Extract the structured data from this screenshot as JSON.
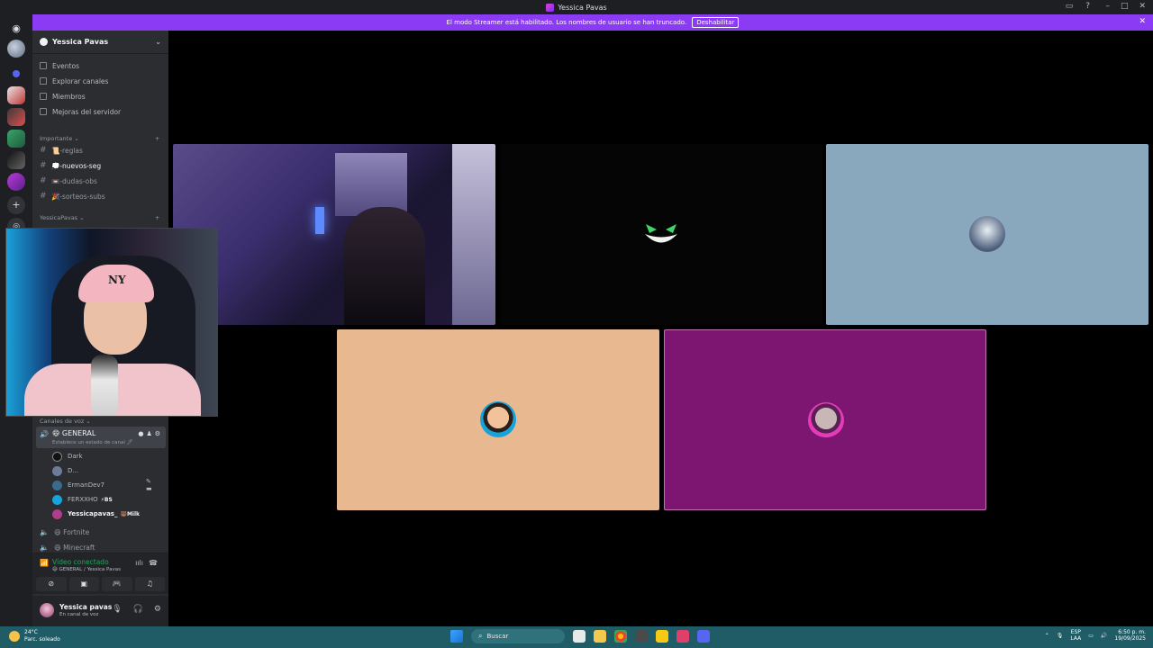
{
  "window": {
    "title": "Yessica Pavas"
  },
  "banner": {
    "text": "El modo Streamer está habilitado. Los nombres de usuario se han truncado.",
    "button": "Deshabilitar"
  },
  "server": {
    "name": "Yessica Pavas"
  },
  "nav": [
    {
      "label": "Eventos"
    },
    {
      "label": "Explorar canales"
    },
    {
      "label": "Miembros"
    },
    {
      "label": "Mejoras del servidor"
    }
  ],
  "categories": {
    "importante": "Importante",
    "yessica": "YessicaPavas",
    "voice": "Canales de voz"
  },
  "text_channels": [
    {
      "label": "📜-reglas"
    },
    {
      "label": "💭-nuevos-seg"
    },
    {
      "label": "📼-dudas-obs"
    },
    {
      "label": "🎉-sorteos-subs"
    }
  ],
  "voice": {
    "channel": "😄 GENERAL",
    "status": "Establece un estado de canal 🖊",
    "users": [
      {
        "name": "Dark",
        "tag": "",
        "color": "#111111"
      },
      {
        "name": "D...",
        "tag": "",
        "color": "#6f7c99"
      },
      {
        "name": "ErmanDev7",
        "tag": "",
        "color": "#3a6b8c"
      },
      {
        "name": "FERXXHO",
        "tag": "⚡BS",
        "color": "#16a3d9"
      },
      {
        "name": "Yessicapavas_",
        "tag": "🐻Milk",
        "color": "#b03c8a"
      }
    ],
    "other_channels": [
      {
        "label": "😄 Fortnite"
      },
      {
        "label": "😄 Minecraft"
      }
    ]
  },
  "rtc": {
    "title": "Vídeo conectado",
    "sub": "😄 GENERAL / Yessica Pavas"
  },
  "user": {
    "name": "Yessica pavas",
    "status": "En canal de voz"
  },
  "taskbar": {
    "temp": "24°C",
    "weather": "Parc. soleado",
    "search": "Buscar",
    "lang1": "ESP",
    "lang2": "LAA",
    "time": "6:50 p. m.",
    "date": "19/09/2025"
  },
  "colors": {
    "accent": "#8c3bf5",
    "connected": "#23a55a",
    "tile_blue": "#8aa8bd",
    "tile_tan": "#e8b990",
    "tile_purple": "#7d1670"
  }
}
